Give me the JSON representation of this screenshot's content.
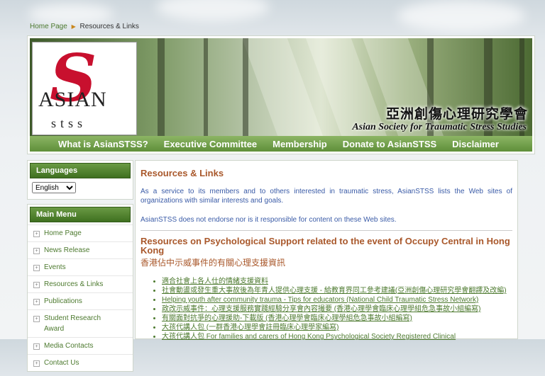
{
  "breadcrumb": {
    "home": "Home Page",
    "current": "Resources & Links"
  },
  "header": {
    "chinese_title": "亞洲創傷心理研究學會",
    "english_title": "Asian Society for Traumatic Stress Studies",
    "logo_s": "S",
    "logo_asian": "ASIAN",
    "logo_stss": "stss"
  },
  "nav": [
    {
      "label": "What is AsianSTSS?"
    },
    {
      "label": "Executive Committee"
    },
    {
      "label": "Membership"
    },
    {
      "label": "Donate to AsianSTSS"
    },
    {
      "label": "Disclaimer"
    }
  ],
  "sidebar": {
    "languages_title": "Languages",
    "language_selected": "English",
    "main_menu_title": "Main Menu",
    "menu": [
      {
        "label": "Home Page"
      },
      {
        "label": "News Release"
      },
      {
        "label": "Events"
      },
      {
        "label": "Resources & Links"
      },
      {
        "label": "Publications"
      },
      {
        "label": "Student Research Award"
      },
      {
        "label": "Media Contacts"
      },
      {
        "label": "Contact Us"
      }
    ]
  },
  "content": {
    "title": "Resources & Links",
    "intro": "As a service to its members and to others interested in traumatic stress, AsianSTSS lists the Web sites of organizations with similar interests and goals.",
    "disclaimer": "AsianSTSS does not endorse nor is it responsible for content on these Web sites.",
    "section_title": "Resources on Psychological Support related to the event of Occupy Central in Hong Kong",
    "section_subtitle": "香港佔中示威事件的有關心理支援資訊",
    "links": [
      {
        "text": "適合社會上各人仕的情緒支援資料"
      },
      {
        "text": "社會動盪或發生重大事故後為年青人提供心理支援 - 給教育界同工參考建議(亞洲創傷心理研究學會翻譯及改編)"
      },
      {
        "text": "Helping youth after community trauma - Tips for educators (National Child Traumatic Stress Network)"
      },
      {
        "text": "政改示威事件：心理支援服務實踐經驗分享會內容撮要 (香港心理學會臨床心理學組危急事故小組編寫)"
      },
      {
        "text": "有關面對抗爭的心理援助-下載版 (香港心理學會臨床心理學組危急事故小組編寫)"
      },
      {
        "text": "大孩代講人包 (一群香港心理學會註冊臨床心理學家編寫)"
      },
      {
        "text": "大孩代講人包 For families and carers of Hong Kong Psychological Society Registered Clinical"
      }
    ]
  }
}
